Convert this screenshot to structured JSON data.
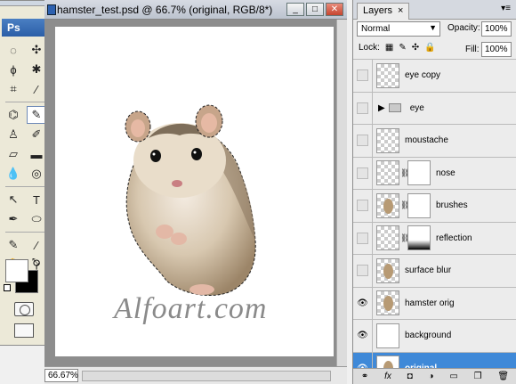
{
  "document": {
    "title": "hamster_test.psd @ 66.7% (original, RGB/8*)",
    "zoom": "66.67%",
    "watermark": "Alfoart.com",
    "window_buttons": [
      "_",
      "□",
      "✕"
    ]
  },
  "toolbox": {
    "logo": "Ps"
  },
  "layers_panel": {
    "tab_label": "Layers",
    "tab_close": "×",
    "menu_glyph": "▾≡",
    "blend_mode": "Normal",
    "opacity_label": "Opacity:",
    "opacity_value": "100%",
    "lock_label": "Lock:",
    "fill_label": "Fill:",
    "fill_value": "100%",
    "layers": [
      {
        "name": "eye copy",
        "visible": false
      },
      {
        "name": "eye",
        "visible": false,
        "group": true
      },
      {
        "name": "moustache",
        "visible": false
      },
      {
        "name": "nose",
        "visible": false
      },
      {
        "name": "brushes",
        "visible": false
      },
      {
        "name": "reflection",
        "visible": false
      },
      {
        "name": "surface blur",
        "visible": false
      },
      {
        "name": "hamster orig",
        "visible": true
      },
      {
        "name": "background",
        "visible": true
      },
      {
        "name": "original",
        "visible": true,
        "selected": true
      }
    ],
    "footer_icons": [
      "link-icon",
      "fx-icon",
      "mask-icon",
      "adjustment-icon",
      "folder-icon",
      "new-layer-icon",
      "trash-icon"
    ]
  }
}
